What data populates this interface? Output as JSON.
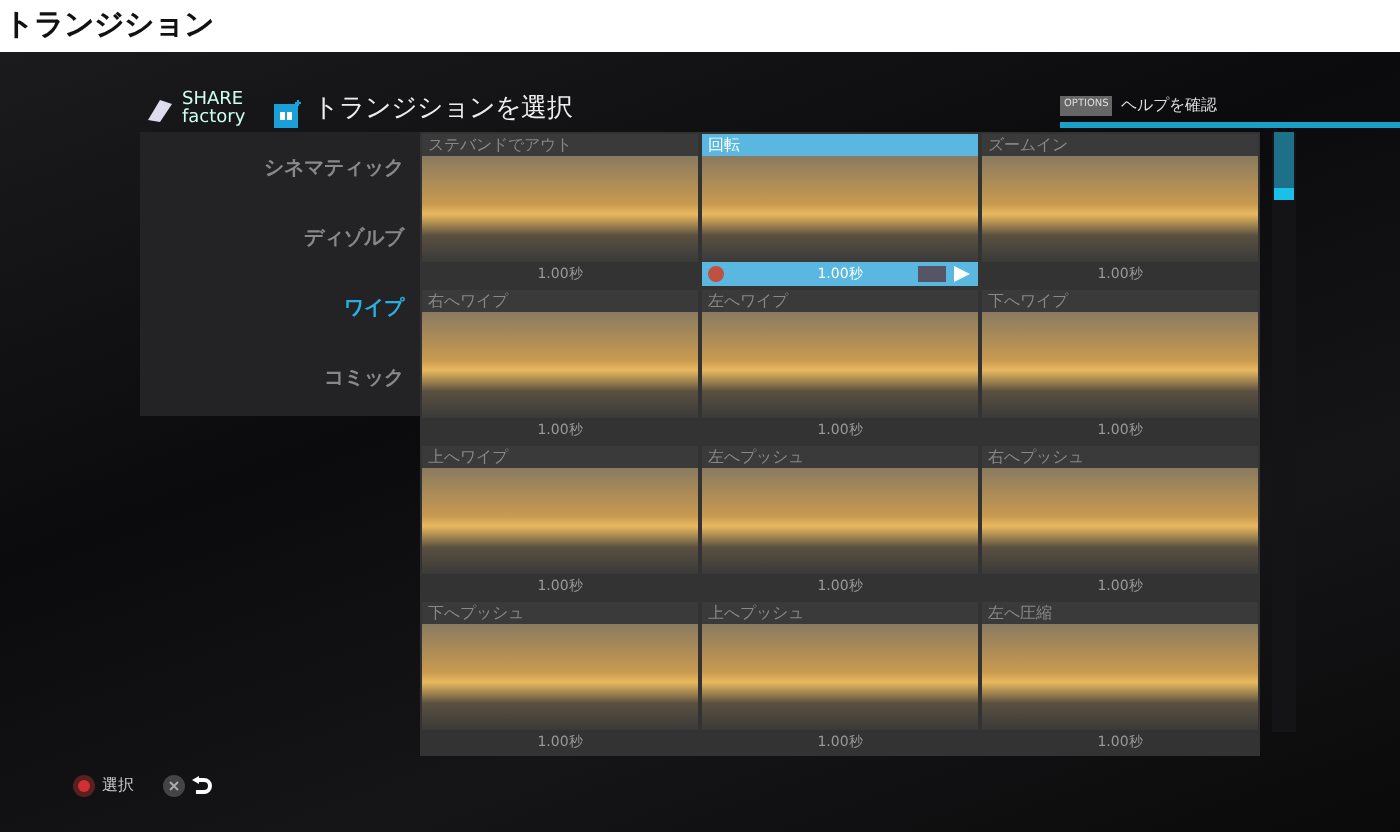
{
  "page_title": "トランジション",
  "header": {
    "logo_top": "SHARE",
    "logo_bottom": "factory",
    "title": "トランジションを選択",
    "options_badge": "OPTIONS",
    "help": "ヘルプを確認"
  },
  "categories": [
    {
      "label": "シネマティック",
      "selected": false
    },
    {
      "label": "ディゾルブ",
      "selected": false
    },
    {
      "label": "ワイプ",
      "selected": true
    },
    {
      "label": "コミック",
      "selected": false
    }
  ],
  "transitions": [
    {
      "name": "ステバンドでアウト",
      "duration": "1.00秒",
      "selected": false
    },
    {
      "name": "回転",
      "duration": "1.00秒",
      "selected": true
    },
    {
      "name": "ズームイン",
      "duration": "1.00秒",
      "selected": false
    },
    {
      "name": "右へワイプ",
      "duration": "1.00秒",
      "selected": false
    },
    {
      "name": "左へワイプ",
      "duration": "1.00秒",
      "selected": false
    },
    {
      "name": "下へワイプ",
      "duration": "1.00秒",
      "selected": false
    },
    {
      "name": "上へワイプ",
      "duration": "1.00秒",
      "selected": false
    },
    {
      "name": "左へプッシュ",
      "duration": "1.00秒",
      "selected": false
    },
    {
      "name": "右へプッシュ",
      "duration": "1.00秒",
      "selected": false
    },
    {
      "name": "下へプッシュ",
      "duration": "1.00秒",
      "selected": false
    },
    {
      "name": "上へプッシュ",
      "duration": "1.00秒",
      "selected": false
    },
    {
      "name": "左へ圧縮",
      "duration": "1.00秒",
      "selected": false
    }
  ],
  "footer": {
    "select_label": "選択"
  }
}
